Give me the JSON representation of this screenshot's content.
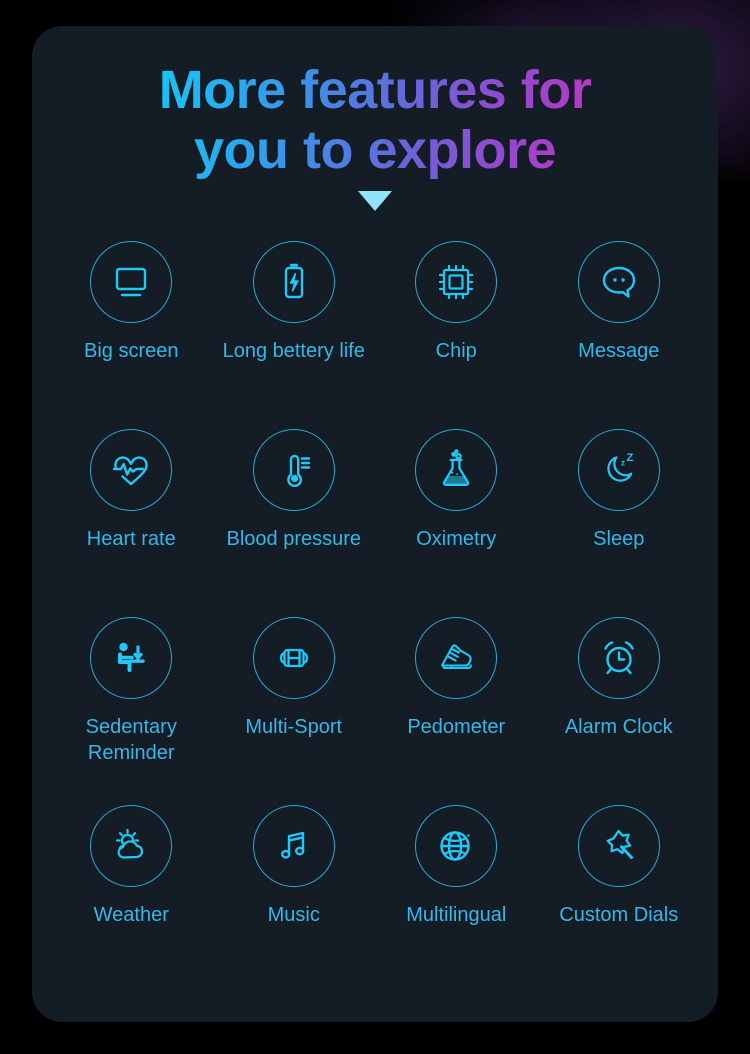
{
  "card": {
    "title_line1": "More features for",
    "title_line2": "you to explore",
    "caret": "down-caret"
  },
  "colors": {
    "page_background": "#000000",
    "card_background": "#141c25",
    "icon_stroke": "#22c8f5",
    "circle_stroke": "#2aa6d6",
    "label_text": "#36b7e8",
    "title_gradient_start": "#12d5f7",
    "title_gradient_end": "#d92fb6",
    "caret_color": "#8fe4fb"
  },
  "features": [
    {
      "label": "Big screen",
      "icon": "monitor-icon"
    },
    {
      "label": "Long bettery life",
      "icon": "battery-bolt-icon"
    },
    {
      "label": "Chip",
      "icon": "chip-icon"
    },
    {
      "label": "Message",
      "icon": "chat-bubble-icon"
    },
    {
      "label": "Heart rate",
      "icon": "heart-pulse-icon"
    },
    {
      "label": "Blood pressure",
      "icon": "thermometer-icon"
    },
    {
      "label": "Oximetry",
      "icon": "flask-icon"
    },
    {
      "label": "Sleep",
      "icon": "moon-zzz-icon"
    },
    {
      "label": "Sedentary\nReminder",
      "icon": "sitting-person-icon"
    },
    {
      "label": "Multi-Sport",
      "icon": "dumbbell-icon"
    },
    {
      "label": "Pedometer",
      "icon": "sneaker-icon"
    },
    {
      "label": "Alarm Clock",
      "icon": "alarm-clock-icon"
    },
    {
      "label": "Weather",
      "icon": "sun-cloud-icon"
    },
    {
      "label": "Music",
      "icon": "music-note-icon"
    },
    {
      "label": "Multilingual",
      "icon": "globe-icon"
    },
    {
      "label": "Custom Dials",
      "icon": "magic-wand-icon"
    }
  ]
}
